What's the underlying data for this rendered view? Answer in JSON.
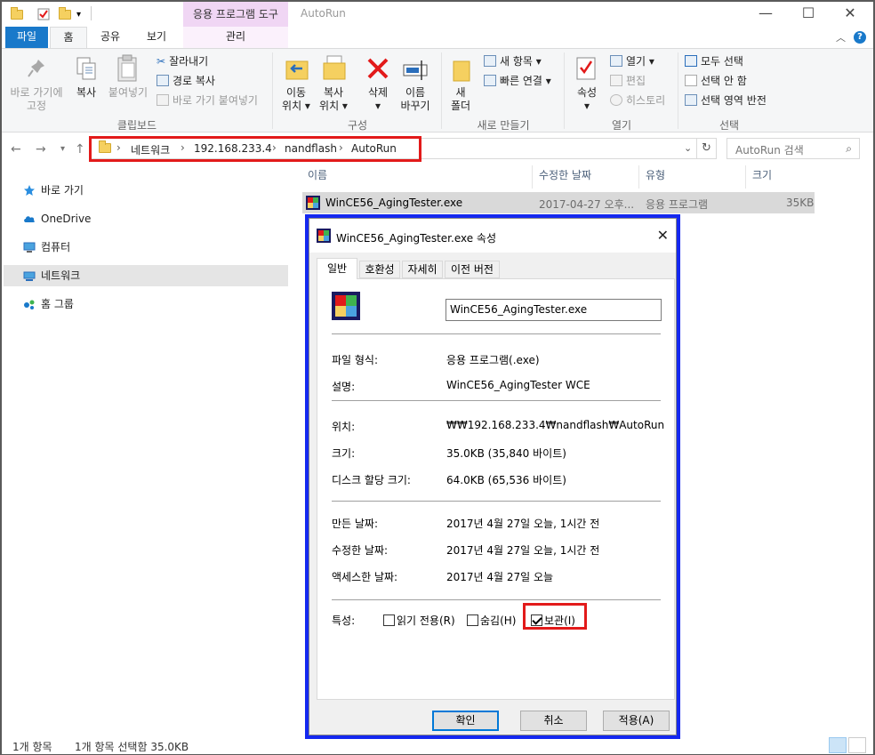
{
  "titlebar": {
    "context_tab": "응용 프로그램 도구",
    "title": "AutoRun",
    "minimize": "—",
    "maximize": "☐",
    "close": "✕"
  },
  "tabs": {
    "file": "파일",
    "home": "홈",
    "share": "공유",
    "view": "보기",
    "manage": "관리",
    "help": "?"
  },
  "ribbon": {
    "pin_label": "바로 가기에\n고정",
    "copy": "복사",
    "paste": "붙여넣기",
    "cut": "잘라내기",
    "copy_path": "경로 복사",
    "paste_shortcut": "바로 가기 붙여넣기",
    "clipboard_group": "클립보드",
    "move_to": "이동\n위치 ▾",
    "copy_to": "복사\n위치 ▾",
    "delete": "삭제\n▾",
    "rename": "이름\n바꾸기",
    "organize_group": "구성",
    "new_folder": "새\n폴더",
    "new_item": "새 항목 ▾",
    "easy_access": "빠른 연결 ▾",
    "new_group": "새로 만들기",
    "properties": "속성\n▾",
    "open": "열기 ▾",
    "edit": "편집",
    "history": "히스토리",
    "open_group": "열기",
    "select_all": "모두 선택",
    "select_none": "선택 안 함",
    "invert_selection": "선택 영역 반전",
    "select_group": "선택"
  },
  "address": {
    "crumbs": [
      "네트워크",
      "192.168.233.4",
      "nandflash",
      "AutoRun"
    ],
    "search_placeholder": "AutoRun 검색"
  },
  "navpane": {
    "items": [
      "바로 가기",
      "OneDrive",
      "컴퓨터",
      "네트워크",
      "홈 그룹"
    ]
  },
  "filelist": {
    "columns": [
      "이름",
      "수정한 날짜",
      "유형",
      "크기"
    ],
    "rows": [
      {
        "name": "WinCE56_AgingTester.exe",
        "date": "2017-04-27 오후...",
        "type": "응용 프로그램",
        "size": "35KB"
      }
    ]
  },
  "status": {
    "count": "1개 항목",
    "selected": "1개 항목 선택함 35.0KB"
  },
  "dialog": {
    "title": "WinCE56_AgingTester.exe 속성",
    "tabs": [
      "일반",
      "호환성",
      "자세히",
      "이전 버전"
    ],
    "filename": "WinCE56_AgingTester.exe",
    "rows": {
      "type_label": "파일 형식:",
      "type_value": "응용 프로그램(.exe)",
      "desc_label": "설명:",
      "desc_value": "WinCE56_AgingTester WCE",
      "location_label": "위치:",
      "location_value": "₩₩192.168.233.4₩nandflash₩AutoRun",
      "size_label": "크기:",
      "size_value": "35.0KB (35,840 바이트)",
      "disk_label": "디스크 할당 크기:",
      "disk_value": "64.0KB (65,536 바이트)",
      "created_label": "만든 날짜:",
      "created_value": "2017년 4월 27일 오늘, 1시간 전",
      "modified_label": "수정한 날짜:",
      "modified_value": "2017년 4월 27일 오늘, 1시간 전",
      "accessed_label": "액세스한 날짜:",
      "accessed_value": "2017년 4월 27일 오늘",
      "attr_label": "특성:"
    },
    "attributes": {
      "readonly": "읽기 전용(R)",
      "hidden": "숨김(H)",
      "archive": "보관(I)"
    },
    "buttons": {
      "ok": "확인",
      "cancel": "취소",
      "apply": "적용(A)"
    },
    "close": "✕"
  },
  "colors": {
    "accent": "#1979ca",
    "highlight_red": "#e21a1a",
    "highlight_blue": "#1428f0"
  }
}
